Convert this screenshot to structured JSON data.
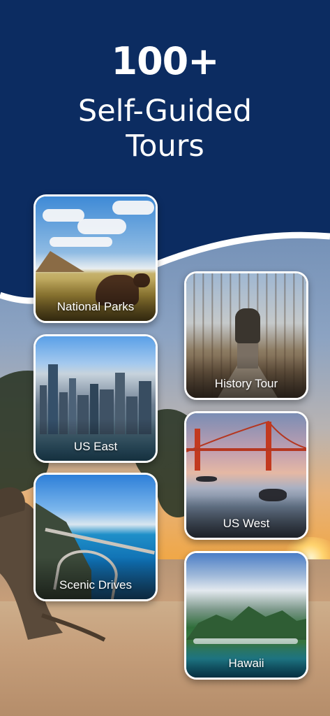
{
  "hero": {
    "count": "100+",
    "line1": "Self-Guided",
    "line2": "Tours"
  },
  "colors": {
    "brand_navy": "#0c2c61",
    "card_border": "#ffffff",
    "label_text": "#ffffff"
  },
  "cards": [
    {
      "label": "National Parks"
    },
    {
      "label": "History Tour"
    },
    {
      "label": "US East"
    },
    {
      "label": "US West"
    },
    {
      "label": "Scenic Drives"
    },
    {
      "label": "Hawaii"
    }
  ]
}
